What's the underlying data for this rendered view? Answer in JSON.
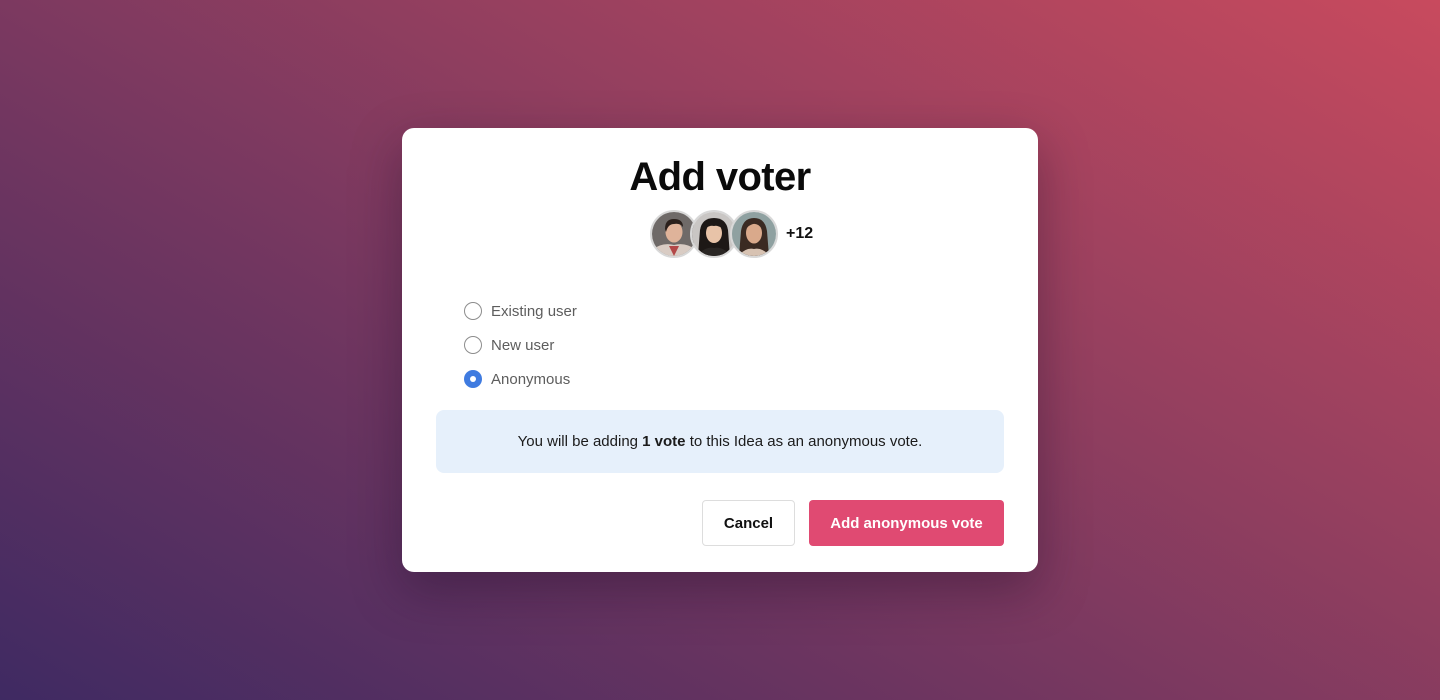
{
  "modal": {
    "title": "Add voter",
    "avatars": [
      {
        "name": "avatar-1",
        "icon": "person-avatar"
      },
      {
        "name": "avatar-2",
        "icon": "person-avatar"
      },
      {
        "name": "avatar-3",
        "icon": "person-avatar"
      }
    ],
    "more_count": "+12",
    "options": [
      {
        "label": "Existing user",
        "checked": false
      },
      {
        "label": "New user",
        "checked": false
      },
      {
        "label": "Anonymous",
        "checked": true
      }
    ],
    "info": {
      "prefix": "You will be adding ",
      "bold": "1 vote",
      "suffix": " to this Idea as an anonymous vote."
    },
    "cancel_label": "Cancel",
    "submit_label": "Add anonymous vote"
  },
  "colors": {
    "accent_button": "#e04a72",
    "radio_selected": "#3f7be0",
    "info_background": "#e6f0fb"
  }
}
